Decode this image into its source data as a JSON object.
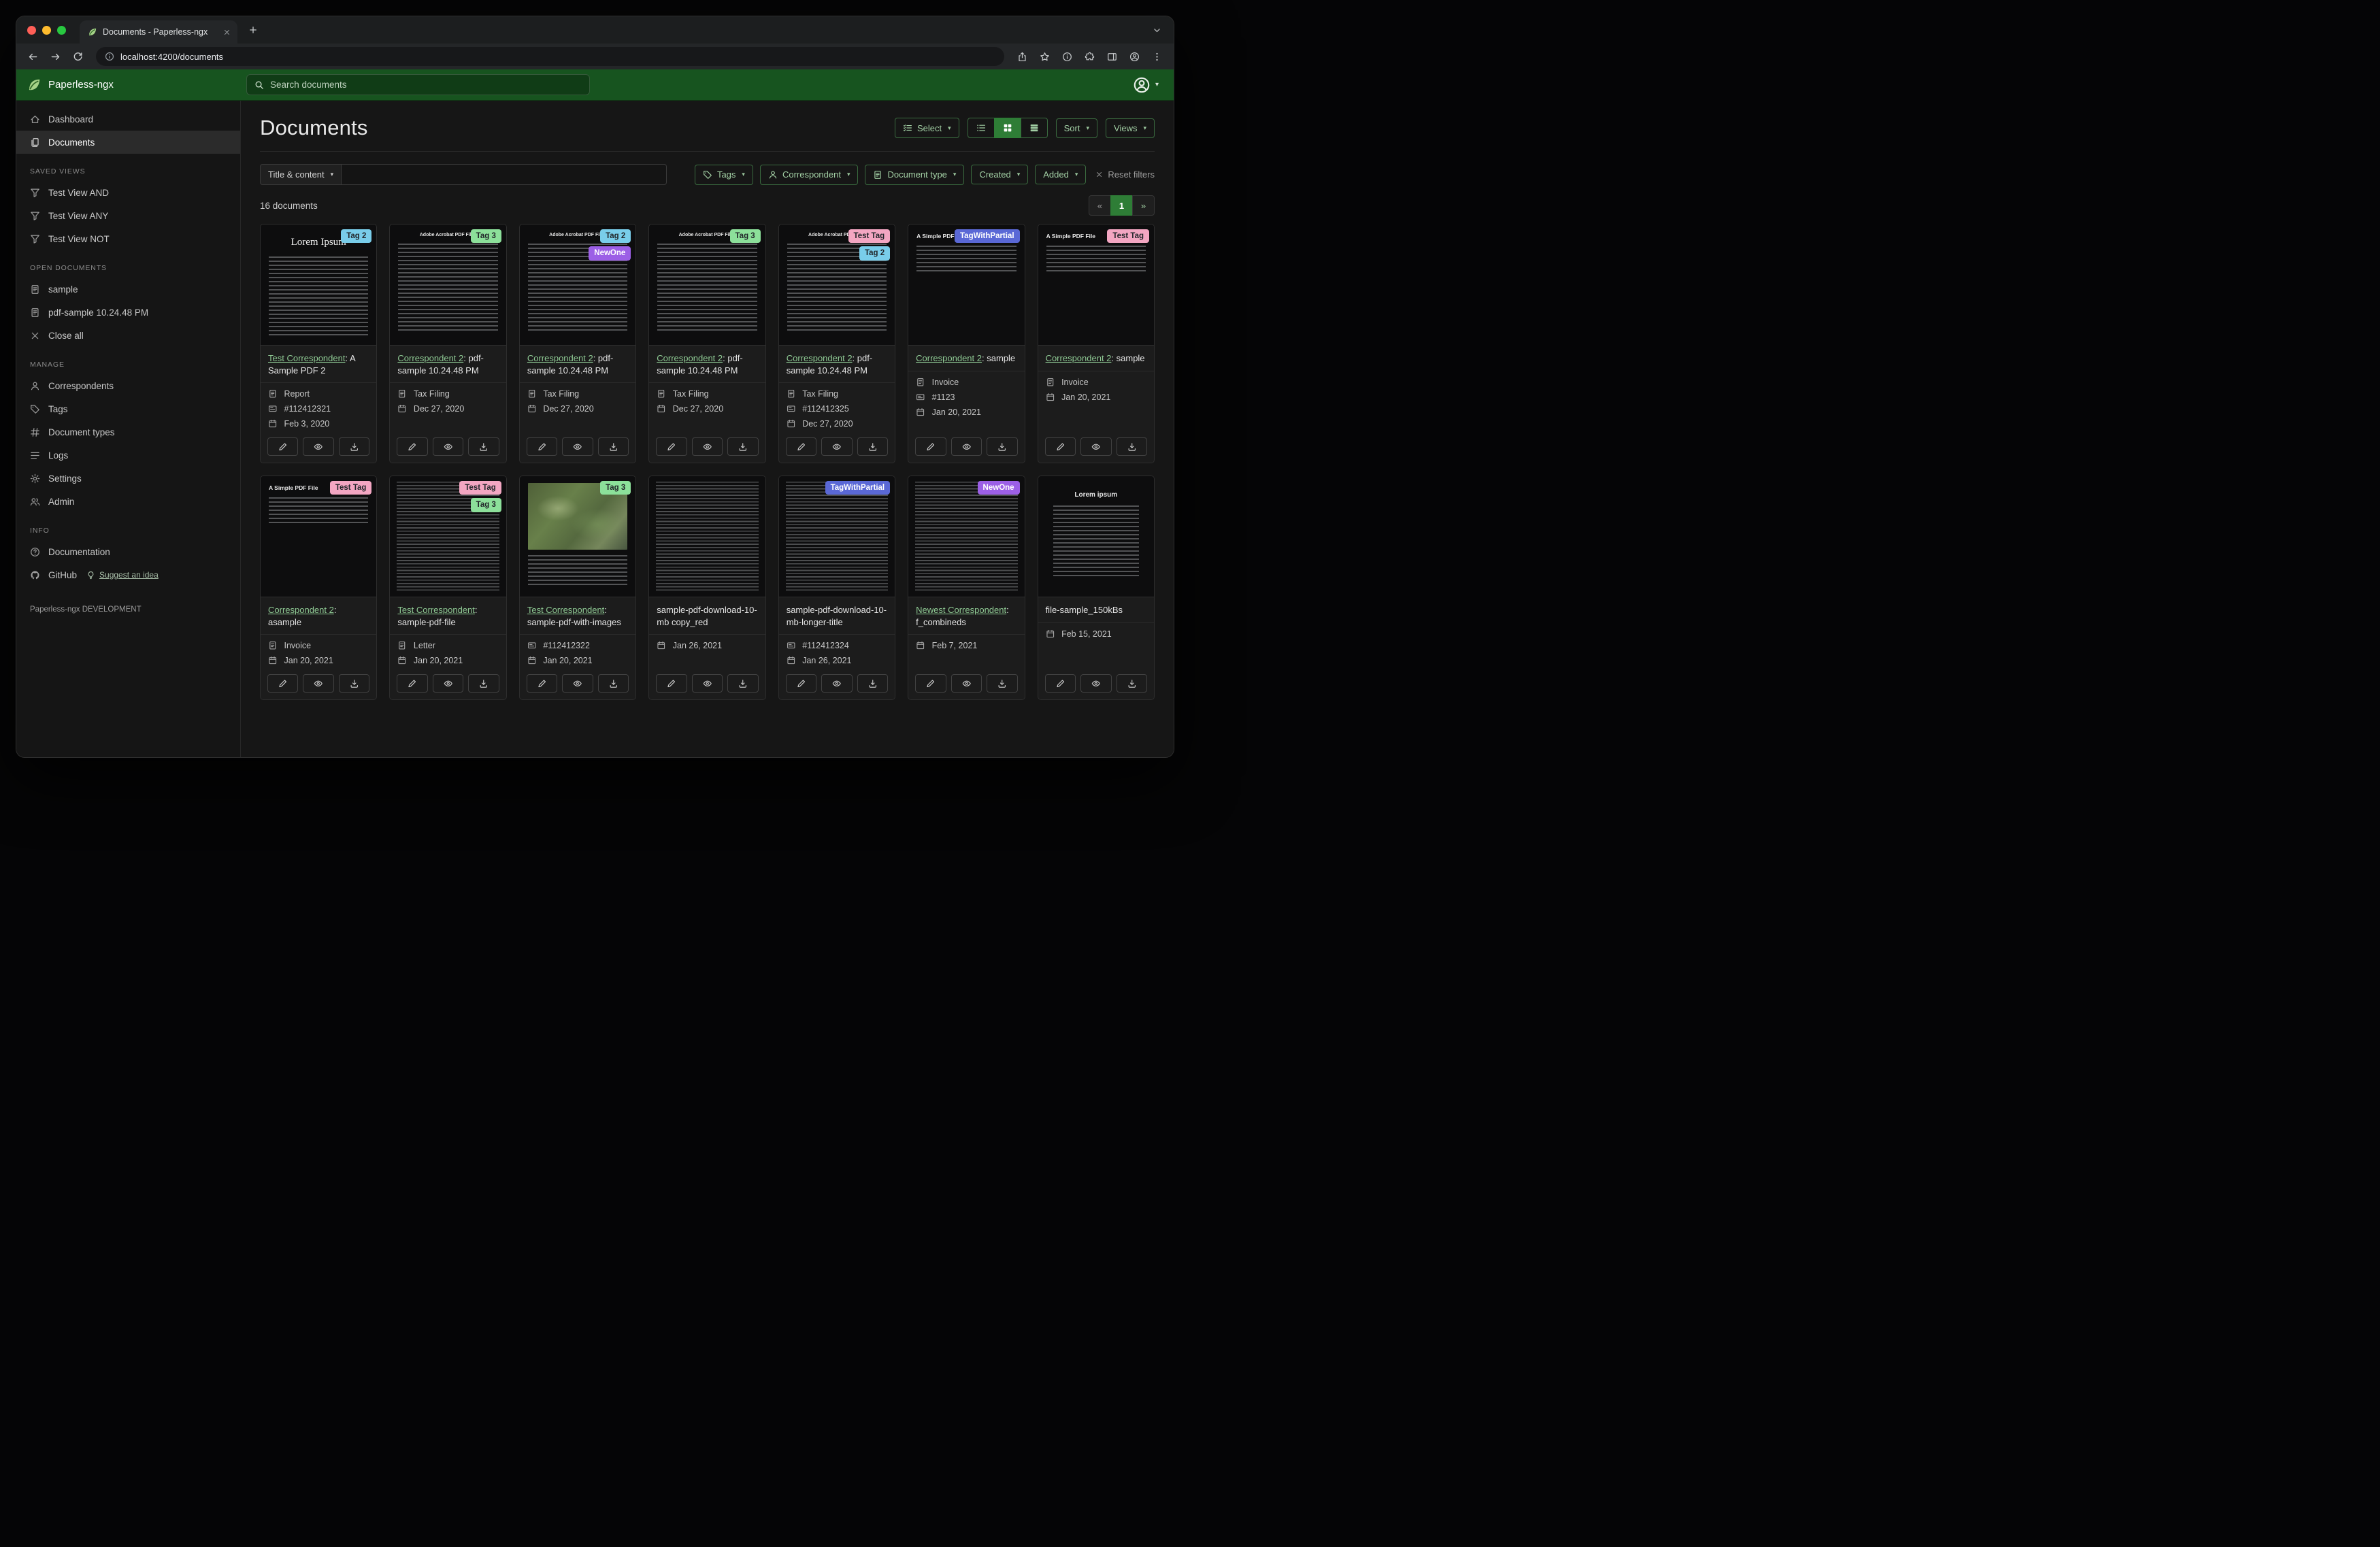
{
  "browser": {
    "tab_title": "Documents - Paperless-ngx",
    "url": "localhost:4200/documents"
  },
  "app_header": {
    "brand": "Paperless-ngx",
    "search_placeholder": "Search documents"
  },
  "sidebar": {
    "dashboard": "Dashboard",
    "documents": "Documents",
    "sections": {
      "saved_views": "SAVED VIEWS",
      "open_documents": "OPEN DOCUMENTS",
      "manage": "MANAGE",
      "info": "INFO"
    },
    "saved_views": [
      "Test View AND",
      "Test View ANY",
      "Test View NOT"
    ],
    "open_documents": [
      "sample",
      "pdf-sample 10.24.48 PM"
    ],
    "close_all": "Close all",
    "manage": [
      "Correspondents",
      "Tags",
      "Document types",
      "Logs",
      "Settings",
      "Admin"
    ],
    "documentation": "Documentation",
    "github": "GitHub",
    "suggest": "Suggest an idea",
    "footer": "Paperless-ngx DEVELOPMENT"
  },
  "toolbar": {
    "title": "Documents",
    "select_label": "Select",
    "sort_label": "Sort",
    "views_label": "Views"
  },
  "filter_bar": {
    "title_content": "Title & content",
    "query_value": "",
    "dropdowns": [
      {
        "label": "Tags",
        "icon": "tag"
      },
      {
        "label": "Correspondent",
        "icon": "person"
      },
      {
        "label": "Document type",
        "icon": "file-text"
      },
      {
        "label": "Created",
        "icon": ""
      },
      {
        "label": "Added",
        "icon": ""
      }
    ],
    "reset": "Reset filters"
  },
  "summary": {
    "count": "16 documents"
  },
  "pagination": {
    "prev": "«",
    "current": "1",
    "next": "»"
  },
  "tags": {
    "Tag 2": {
      "bg": "#79cdea",
      "fg": "#212529"
    },
    "Tag 3": {
      "bg": "#8ce09a",
      "fg": "#212529"
    },
    "NewOne": {
      "bg": "#9c5fe6",
      "fg": "#ffffff"
    },
    "Test Tag": {
      "bg": "#f3a6c2",
      "fg": "#212529"
    },
    "TagWithPartial": {
      "bg": "#5a68d6",
      "fg": "#ffffff"
    }
  },
  "documents": [
    {
      "tags": [
        "Tag 2"
      ],
      "correspondent": "Test Correspondent",
      "title_rest": ": A Sample PDF 2",
      "doc_type": "Report",
      "asn": "#112412321",
      "created": "Feb 3, 2020",
      "thumb": {
        "kind": "lorem",
        "heading": "Lorem Ipsum"
      }
    },
    {
      "tags": [
        "Tag 3"
      ],
      "correspondent": "Correspondent 2",
      "title_rest": ": pdf-sample 10.24.48 PM",
      "doc_type": "Tax Filing",
      "asn": "",
      "created": "Dec 27, 2020",
      "thumb": {
        "kind": "acrobat",
        "heading": "Adobe Acrobat PDF Files"
      }
    },
    {
      "tags": [
        "Tag 2",
        "NewOne"
      ],
      "correspondent": "Correspondent 2",
      "title_rest": ": pdf-sample 10.24.48 PM",
      "doc_type": "Tax Filing",
      "asn": "",
      "created": "Dec 27, 2020",
      "thumb": {
        "kind": "acrobat",
        "heading": "Adobe Acrobat PDF Files"
      }
    },
    {
      "tags": [
        "Tag 3"
      ],
      "correspondent": "Correspondent 2",
      "title_rest": ": pdf-sample 10.24.48 PM",
      "doc_type": "Tax Filing",
      "asn": "",
      "created": "Dec 27, 2020",
      "thumb": {
        "kind": "acrobat",
        "heading": "Adobe Acrobat PDF Files"
      }
    },
    {
      "tags": [
        "Test Tag",
        "Tag 2"
      ],
      "correspondent": "Correspondent 2",
      "title_rest": ": pdf-sample 10.24.48 PM",
      "doc_type": "Tax Filing",
      "asn": "#112412325",
      "created": "Dec 27, 2020",
      "thumb": {
        "kind": "acrobat",
        "heading": "Adobe Acrobat PDF Files"
      }
    },
    {
      "tags": [
        "TagWithPartial"
      ],
      "correspondent": "Correspondent 2",
      "title_rest": ": sample",
      "doc_type": "Invoice",
      "asn": "#1123",
      "created": "Jan 20, 2021",
      "thumb": {
        "kind": "simple",
        "heading": "A Simple PDF File"
      }
    },
    {
      "tags": [
        "Test Tag"
      ],
      "correspondent": "Correspondent 2",
      "title_rest": ": sample",
      "doc_type": "Invoice",
      "asn": "",
      "created": "Jan 20, 2021",
      "thumb": {
        "kind": "simple",
        "heading": "A Simple PDF File"
      }
    },
    {
      "tags": [
        "Test Tag"
      ],
      "correspondent": "Correspondent 2",
      "title_rest": ": asample",
      "doc_type": "Invoice",
      "asn": "",
      "created": "Jan 20, 2021",
      "thumb": {
        "kind": "simple",
        "heading": "A Simple PDF File"
      }
    },
    {
      "tags": [
        "Test Tag",
        "Tag 3"
      ],
      "correspondent": "Test Correspondent",
      "title_rest": ": sample-pdf-file",
      "doc_type": "Letter",
      "asn": "",
      "created": "Jan 20, 2021",
      "thumb": {
        "kind": "dense",
        "heading": ""
      }
    },
    {
      "tags": [
        "Tag 3"
      ],
      "correspondent": "Test Correspondent",
      "title_rest": ": sample-pdf-with-images",
      "doc_type": "",
      "asn": "#112412322",
      "created": "Jan 20, 2021",
      "thumb": {
        "kind": "map",
        "heading": ""
      }
    },
    {
      "tags": [],
      "correspondent": "",
      "title_rest": "sample-pdf-download-10-mb copy_red",
      "doc_type": "",
      "asn": "",
      "created": "Jan 26, 2021",
      "thumb": {
        "kind": "dense",
        "heading": ""
      }
    },
    {
      "tags": [
        "TagWithPartial"
      ],
      "correspondent": "",
      "title_rest": "sample-pdf-download-10-mb-longer-title",
      "doc_type": "",
      "asn": "#112412324",
      "created": "Jan 26, 2021",
      "thumb": {
        "kind": "dense",
        "heading": ""
      }
    },
    {
      "tags": [
        "NewOne"
      ],
      "correspondent": "Newest Correspondent",
      "title_rest": ": f_combineds",
      "doc_type": "",
      "asn": "",
      "created": "Feb 7, 2021",
      "thumb": {
        "kind": "dense",
        "heading": ""
      }
    },
    {
      "tags": [],
      "correspondent": "",
      "title_rest": "file-sample_150kBs",
      "doc_type": "",
      "asn": "",
      "created": "Feb 15, 2021",
      "thumb": {
        "kind": "lorem-center",
        "heading": "Lorem ipsum"
      }
    }
  ]
}
